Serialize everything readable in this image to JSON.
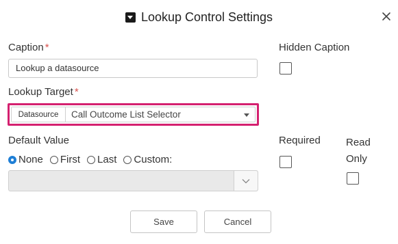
{
  "dialog": {
    "title": "Lookup Control Settings",
    "icon": "caret-square-down-icon",
    "close_symbol": "✕"
  },
  "caption": {
    "label": "Caption",
    "required_mark": "*",
    "value": "Lookup a datasource"
  },
  "hidden_caption": {
    "label": "Hidden Caption",
    "checked": false
  },
  "lookup_target": {
    "label": "Lookup Target",
    "required_mark": "*",
    "type_label": "Datasource",
    "selected": "Call Outcome List Selector",
    "highlight_color": "#d4206f"
  },
  "default_value": {
    "label": "Default Value",
    "options": [
      {
        "label": "None",
        "selected": true
      },
      {
        "label": "First",
        "selected": false
      },
      {
        "label": "Last",
        "selected": false
      },
      {
        "label": "Custom:",
        "selected": false
      }
    ],
    "custom_value": ""
  },
  "required": {
    "label": "Required",
    "checked": false
  },
  "read_only": {
    "label_line1": "Read",
    "label_line2": "Only",
    "checked": false
  },
  "footer": {
    "save_label": "Save",
    "cancel_label": "Cancel"
  },
  "colors": {
    "accent": "#1f7fd6",
    "required": "#d9534f"
  }
}
